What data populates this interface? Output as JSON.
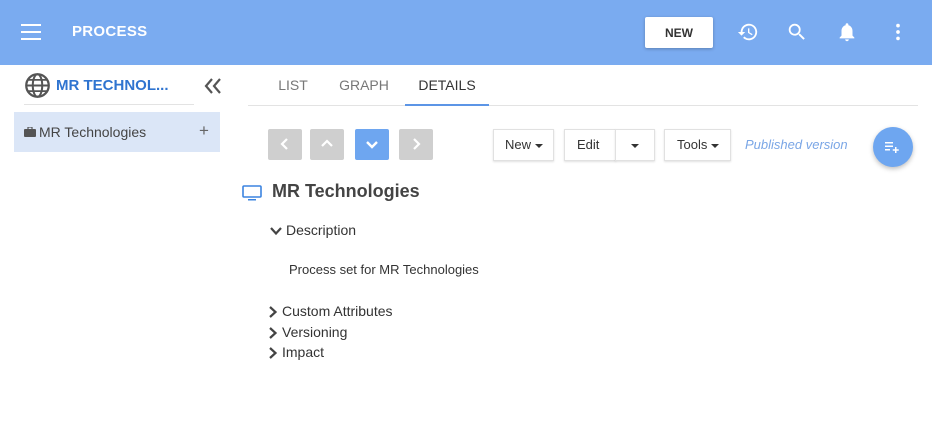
{
  "app": {
    "title": "PROCESS",
    "new_button": "NEW",
    "icons": [
      "menu-icon",
      "history-icon",
      "search-icon",
      "bell-icon",
      "more-vert-icon"
    ]
  },
  "sidebar": {
    "title": "MR TECHNOL...",
    "items": [
      {
        "label": "MR Technologies",
        "icon": "briefcase-icon"
      }
    ]
  },
  "tabs": [
    {
      "label": "LIST"
    },
    {
      "label": "GRAPH"
    },
    {
      "label": "DETAILS",
      "active": true
    }
  ],
  "toolbar": {
    "new_label": "New",
    "edit_label": "Edit",
    "tools_label": "Tools",
    "status": "Published version"
  },
  "detail": {
    "title": "MR Technologies",
    "sections": [
      {
        "label": "Description",
        "expanded": true,
        "content": "Process set for MR Technologies"
      },
      {
        "label": "Custom Attributes",
        "expanded": false
      },
      {
        "label": "Versioning",
        "expanded": false
      },
      {
        "label": "Impact",
        "expanded": false
      }
    ]
  },
  "colors": {
    "appbar": "#7aabf0",
    "accent": "#2f74d0",
    "selection": "#dbe6f7",
    "status_text": "#7aa6e6"
  }
}
